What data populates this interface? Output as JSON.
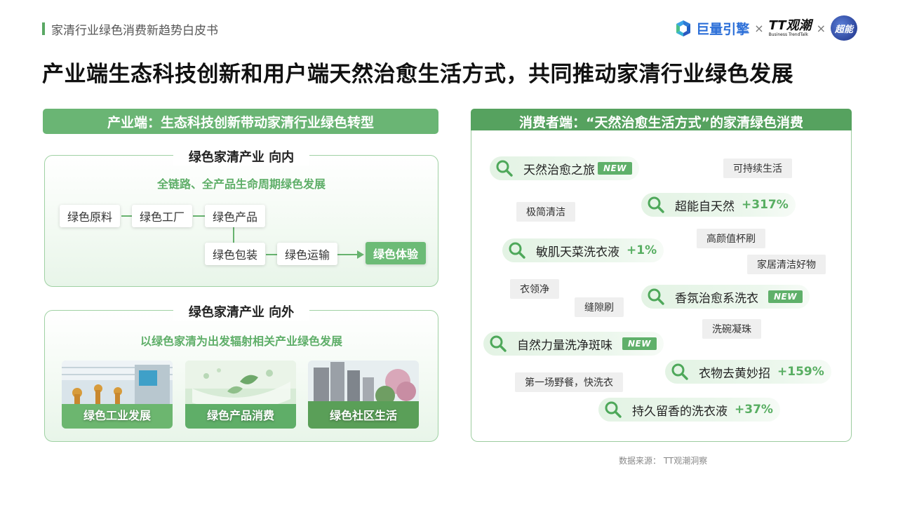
{
  "header": {
    "label": "家清行业绿色消费新趋势白皮书",
    "title": "产业端生态科技创新和用户端天然治愈生活方式，共同推动家清行业绿色发展",
    "logos": {
      "brand1": "巨量引擎",
      "times": "×",
      "brand2_main": "TT观潮",
      "brand2_sub": "Business TrendTalk",
      "brand3": "超能"
    }
  },
  "left_panel": {
    "header": "产业端：生态科技创新带动家清行业绿色转型",
    "inward": {
      "title": "绿色家清产业 向内",
      "subtitle": "全链路、全产品生命周期绿色发展",
      "nodes": [
        "绿色原料",
        "绿色工厂",
        "绿色产品",
        "绿色包装",
        "绿色运输",
        "绿色体验"
      ]
    },
    "outward": {
      "title": "绿色家清产业 向外",
      "subtitle": "以绿色家清为出发辐射相关产业绿色发展",
      "images": [
        "绿色工业发展",
        "绿色产品消费",
        "绿色社区生活"
      ]
    }
  },
  "right_panel": {
    "header": "消费者端：“天然治愈生活方式”的家清绿色消费",
    "keywords": [
      {
        "text": "天然治愈之旅",
        "badge": "NEW"
      },
      {
        "text": "超能自天然",
        "pct": "+317%"
      },
      {
        "text": "敏肌天菜洗衣液",
        "pct": "+1%"
      },
      {
        "text": "香氛治愈系洗衣",
        "badge": "NEW"
      },
      {
        "text": "自然力量洗净斑味",
        "badge": "NEW"
      },
      {
        "text": "衣物去黄妙招",
        "pct": "+159%"
      },
      {
        "text": "持久留香的洗衣液",
        "pct": "+37%"
      }
    ],
    "tags": [
      "可持续生活",
      "极简清洁",
      "高颜值杯刷",
      "家居清洁好物",
      "衣领净",
      "缝隙刷",
      "洗碗凝珠",
      "第一场野餐，快洗衣"
    ]
  },
  "source": "数据来源： TT观潮洞察",
  "colors": {
    "accent": "#5eae68",
    "panel_header": "#6ab574",
    "brand_blue": "#2c6fd8"
  }
}
